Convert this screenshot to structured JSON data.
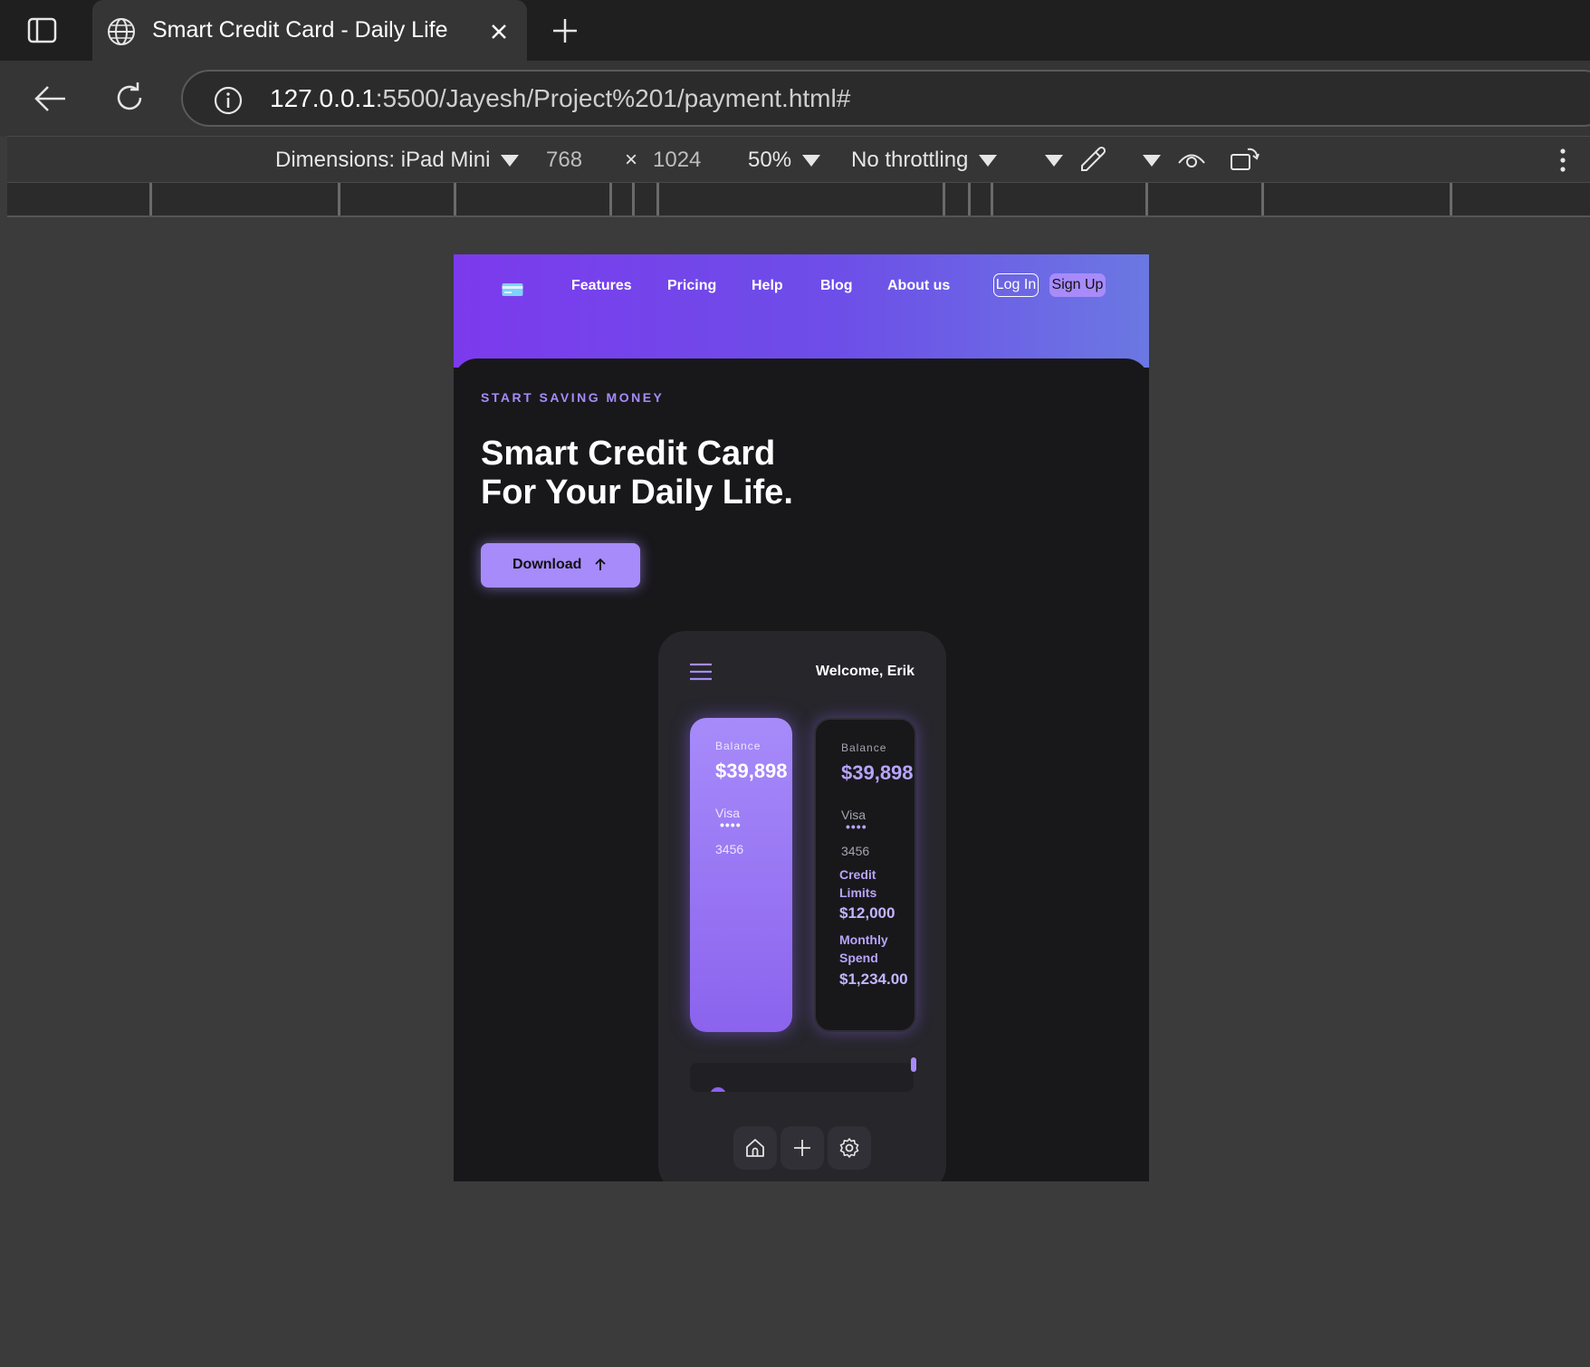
{
  "browser": {
    "tab_title": "Smart Credit Card - Daily Life",
    "url_host": "127.0.0.1",
    "url_rest": ":5500/Jayesh/Project%201/payment.html#"
  },
  "devtools": {
    "dimensions_label": "Dimensions: iPad Mini",
    "width": "768",
    "times": "×",
    "height": "1024",
    "zoom": "50%",
    "throttling": "No throttling"
  },
  "site": {
    "nav": [
      "Features",
      "Pricing",
      "Help",
      "Blog",
      "About us"
    ],
    "login_label": "Log In",
    "signup_label": "Sign Up",
    "eyebrow": "START SAVING MONEY",
    "title_line1": "Smart Credit Card",
    "title_line2": "For Your Daily Life.",
    "download_label": "Download",
    "accent_color": "#a78bfa",
    "header_gradient": [
      "#7c3aed",
      "#6b78e2"
    ]
  },
  "app": {
    "welcome": "Welcome, Erik",
    "cards": [
      {
        "label": "Balance",
        "amount": "$39,898",
        "brand": "Visa",
        "dots": "••••",
        "last4": "3456"
      },
      {
        "label": "Balance",
        "amount": "$39,898",
        "brand": "Visa",
        "dots": "••••",
        "last4": "3456",
        "credit_limit_label": "Credit Limits",
        "credit_limit": "$12,000",
        "monthly_spend_label": "Monthly Spend",
        "monthly_spend": "$1,234.00"
      }
    ],
    "bottom_nav_icons": [
      "home-icon",
      "plus-icon",
      "gear-icon"
    ]
  }
}
